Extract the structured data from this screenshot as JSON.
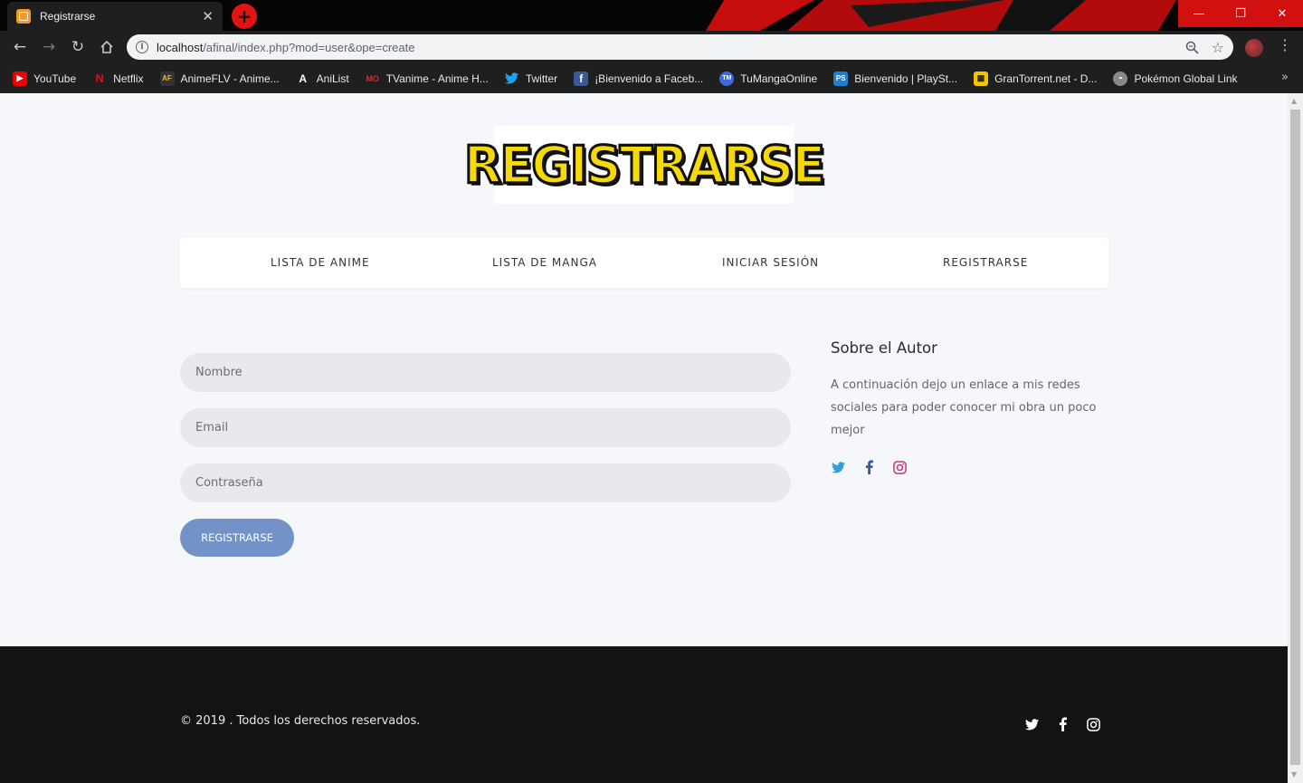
{
  "browser": {
    "tab_title": "Registrarse",
    "url_host": "localhost",
    "url_path": "/afinal/index.php?mod=user&ope=create",
    "bookmarks": [
      {
        "label": "YouTube",
        "icon": "youtube-icon"
      },
      {
        "label": "Netflix",
        "icon": "netflix-icon"
      },
      {
        "label": "AnimeFLV - Anime...",
        "icon": "animeflv-icon"
      },
      {
        "label": "AniList",
        "icon": "anilist-icon"
      },
      {
        "label": "TVanime - Anime H...",
        "icon": "tvanime-icon"
      },
      {
        "label": "Twitter",
        "icon": "twitter-icon"
      },
      {
        "label": "¡Bienvenido a Faceb...",
        "icon": "facebook-icon"
      },
      {
        "label": "TuMangaOnline",
        "icon": "tumanga-icon"
      },
      {
        "label": "Bienvenido | PlaySt...",
        "icon": "playstation-icon"
      },
      {
        "label": "GranTorrent.net - D...",
        "icon": "grantorrent-icon"
      },
      {
        "label": "Pokémon Global Link",
        "icon": "pokemon-icon"
      }
    ]
  },
  "header": {
    "logo_text": "REGISTRARSE"
  },
  "nav": {
    "items": [
      {
        "label": "LISTA DE ANIME"
      },
      {
        "label": "LISTA DE MANGA"
      },
      {
        "label": "INICIAR SESIÓN"
      },
      {
        "label": "REGISTRARSE"
      }
    ]
  },
  "form": {
    "name_placeholder": "Nombre",
    "email_placeholder": "Email",
    "password_placeholder": "Contraseña",
    "submit_label": "REGISTRARSE"
  },
  "sidebar": {
    "title": "Sobre el Autor",
    "text": "A continuación dejo un enlace a mis redes sociales para poder conocer mi obra un poco mejor",
    "social": [
      "twitter-icon",
      "facebook-icon",
      "instagram-icon"
    ]
  },
  "footer": {
    "copyright": "© 2019 . Todos los derechos reservados."
  },
  "colors": {
    "accent_button": "#7393c8",
    "footer_bg": "#131313",
    "twitter": "#1da1f2",
    "facebook": "#3b5998",
    "instagram": "#c13584"
  }
}
